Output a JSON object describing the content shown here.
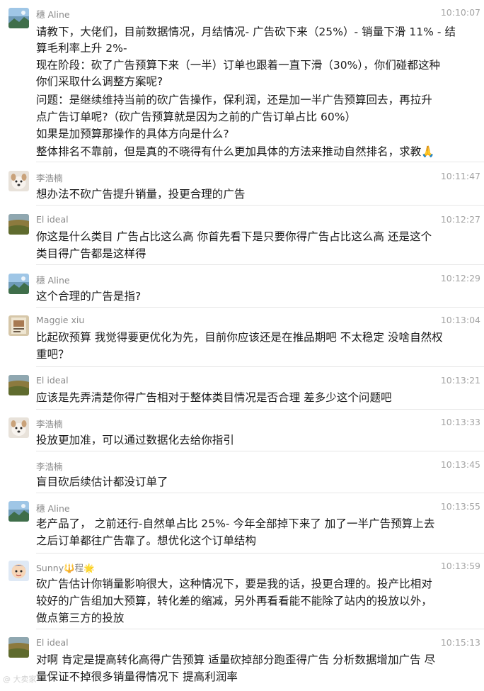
{
  "colors": {
    "sender": "#8a8a8a",
    "time": "#a4a4a4",
    "text": "#1a1a1a",
    "divider": "#e6e6e6"
  },
  "messages": [
    {
      "sender": "穗 Aline",
      "time": "10:10:07",
      "avatar": "landscape-avatar",
      "lines": [
        "请教下，大佬们，目前数据情况，月结情况- 广告砍下来（25%）- 销量下滑 11% - 结",
        "算毛利率上升 2%-",
        "现在阶段：砍了广告预算下来（一半）订单也跟着一直下滑（30%），你们碰都这种",
        "你们采取什么调整方案呢?",
        "问题：是继续维持当前的砍广告操作，保利润，还是加一半广告预算回去，再拉升",
        "点广告订单呢?（砍广告预算就是因为之前的广告订单占比 60%）",
        "如果是加预算那操作的具体方向是什么?",
        "整体排名不靠前，但是真的不晓得有什么更加具体的方法来推动自然排名，求教🙏"
      ]
    },
    {
      "sender": "李浩楠",
      "time": "10:11:47",
      "avatar": "dog-avatar",
      "lines": [
        "想办法不砍广告提升销量，投更合理的广告"
      ]
    },
    {
      "sender": "El ideal",
      "time": "10:12:27",
      "avatar": "field-avatar",
      "lines": [
        "你这是什么类目 广告占比这么高 你首先看下是只要你得广告占比这么高 还是这个",
        "类目得广告都是这样得"
      ]
    },
    {
      "sender": "穗 Aline",
      "time": "10:12:29",
      "avatar": "landscape-avatar",
      "lines": [
        "这个合理的广告是指?"
      ]
    },
    {
      "sender": "Maggie xiu",
      "time": "10:13:04",
      "avatar": "card-avatar",
      "lines": [
        "比起砍预算 我觉得要更优化为先，目前你应该还是在推品期吧 不太稳定 没啥自然权",
        "重吧？"
      ]
    },
    {
      "sender": "El ideal",
      "time": "10:13:21",
      "avatar": "field-avatar",
      "lines": [
        "应该是先弄清楚你得广告相对于整体类目情况是否合理 差多少这个问题吧"
      ]
    },
    {
      "sender": "李浩楠",
      "time": "10:13:33",
      "avatar": "dog-avatar",
      "lines": [
        "投放更加准，可以通过数据化去给你指引"
      ]
    },
    {
      "sender": "李浩楠",
      "time": "10:13:45",
      "avatar": "",
      "lines": [
        "盲目砍后续估计都没订单了"
      ]
    },
    {
      "sender": "穗 Aline",
      "time": "10:13:55",
      "avatar": "landscape-avatar",
      "lines": [
        "老产品了， 之前还行-自然单占比 25%- 今年全部掉下来了 加了一半广告预算上去",
        "之后订单都往广告靠了。想优化这个订单结构"
      ]
    },
    {
      "sender": "Sunny🔱程🌟",
      "time": "10:13:59",
      "avatar": "cartoon-avatar",
      "lines": [
        "砍广告估计你销量影响很大，这种情况下，要是我的话，投更合理的。投产比相对",
        "较好的广告组加大预算，转化差的缩减，另外再看看能不能除了站内的投放以外，",
        "做点第三方的投放"
      ]
    },
    {
      "sender": "El ideal",
      "time": "10:15:13",
      "avatar": "field-avatar",
      "lines": [
        "对啊 肯定是提高转化高得广告预算 适量砍掉部分跑歪得广告 分析数据增加广告 尽",
        "量保证不掉很多销量得情况下 提高利润率"
      ]
    }
  ],
  "watermark": "@ 大卖家"
}
